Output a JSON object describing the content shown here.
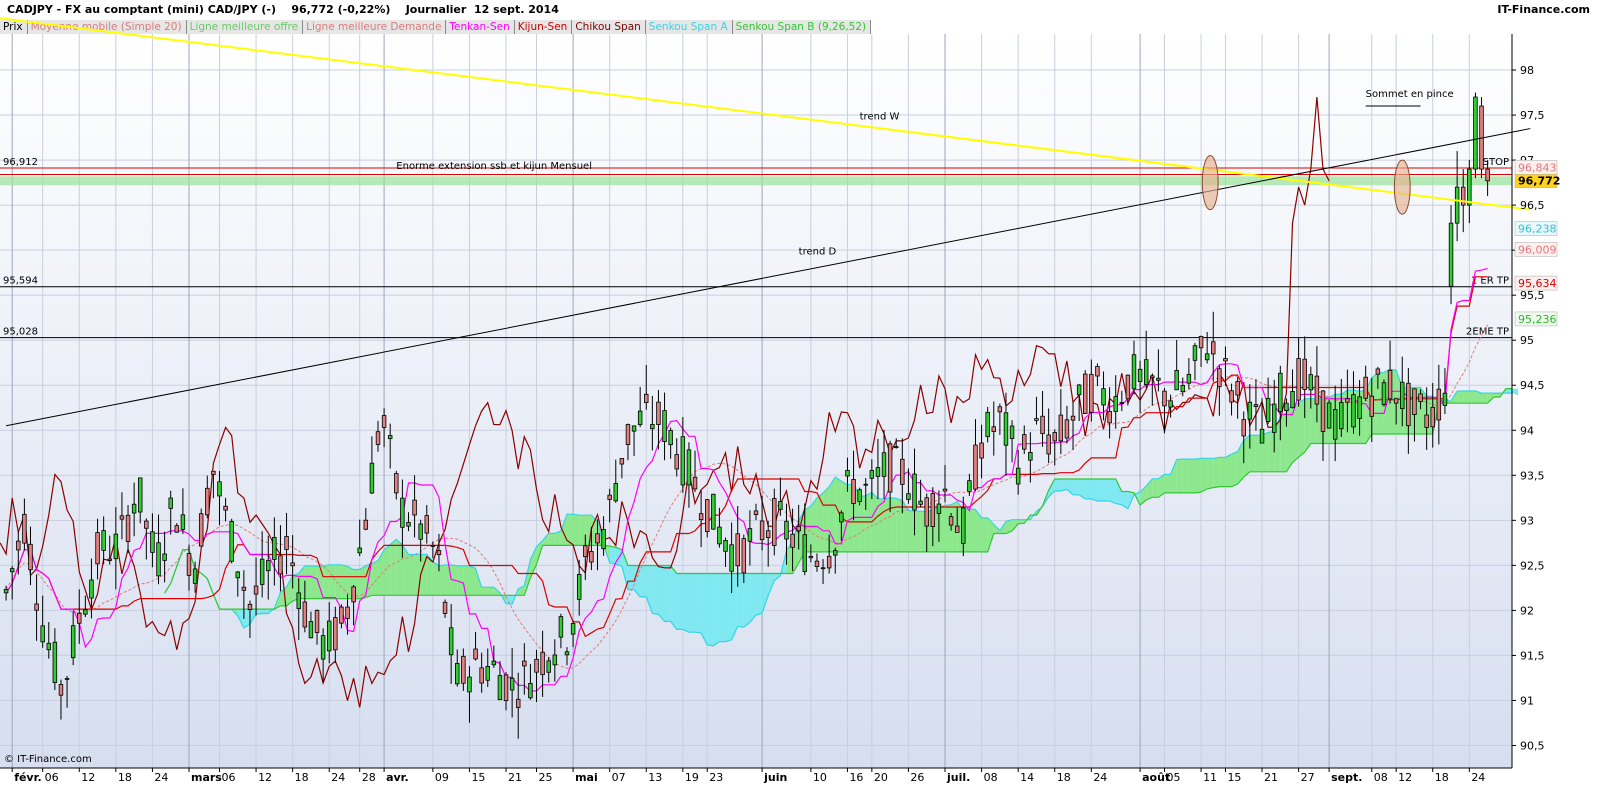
{
  "header": {
    "title": "CADJPY - FX au comptant (mini) CAD/JPY (-)    96,772 (-0,22%)    Journalier  12 sept. 2014",
    "site": "IT-Finance.com"
  },
  "legend": [
    {
      "label": "Prix",
      "color": "#000000"
    },
    {
      "label": "Moyenne mobile (Simple 20)",
      "color": "#e07a7a"
    },
    {
      "label": "Ligne meilleure offre",
      "color": "#66cc66"
    },
    {
      "label": "Ligne meilleure Demande",
      "color": "#e07a7a"
    },
    {
      "label": "Tenkan-Sen",
      "color": "#ff00ff"
    },
    {
      "label": "Kijun-Sen",
      "color": "#cc0000"
    },
    {
      "label": "Chikou Span",
      "color": "#800000"
    },
    {
      "label": "Senkou Span A",
      "color": "#33d6e6"
    },
    {
      "label": "Senkou Span B (9,26,52)",
      "color": "#33c833"
    }
  ],
  "colors": {
    "up": "#33cc33",
    "down": "#e08080",
    "wick": "#000000",
    "tenkan": "#ff00ff",
    "kijun": "#dd0000",
    "chikou": "#8b0000",
    "sma": "#e07a7a",
    "cloudBull": "#8de88d",
    "cloudBear": "#7fe8f0",
    "trendW": "#ffff00",
    "trendD": "#000000"
  },
  "chart_data": {
    "type": "candlestick",
    "title": "CADJPY - FX au comptant (mini) CAD/JPY (-)",
    "ylim": [
      90.25,
      98.4
    ],
    "yticks": [
      "98",
      "97,5",
      "97",
      "96,5",
      "96",
      "95,5",
      "95",
      "94,5",
      "94",
      "93,5",
      "93",
      "92,5",
      "92",
      "91,5",
      "91",
      "90,5"
    ],
    "ytick_values": [
      98,
      97.5,
      97,
      96.5,
      96,
      95.5,
      95,
      94.5,
      94,
      93.5,
      93,
      92.5,
      92,
      91.5,
      91,
      90.5
    ],
    "xlabels": [
      {
        "day": 1,
        "text": "févr.",
        "bold": true
      },
      {
        "day": 6,
        "text": "06"
      },
      {
        "day": 12,
        "text": "12"
      },
      {
        "day": 18,
        "text": "18"
      },
      {
        "day": 24,
        "text": "24"
      },
      {
        "day": 30,
        "text": "mars",
        "bold": true
      },
      {
        "day": 35,
        "text": "06"
      },
      {
        "day": 41,
        "text": "12"
      },
      {
        "day": 47,
        "text": "18"
      },
      {
        "day": 53,
        "text": "24"
      },
      {
        "day": 58,
        "text": "28"
      },
      {
        "day": 62,
        "text": "avr.",
        "bold": true
      },
      {
        "day": 70,
        "text": "09"
      },
      {
        "day": 76,
        "text": "15"
      },
      {
        "day": 82,
        "text": "21"
      },
      {
        "day": 87,
        "text": "25"
      },
      {
        "day": 93,
        "text": "mai",
        "bold": true
      },
      {
        "day": 99,
        "text": "07"
      },
      {
        "day": 105,
        "text": "13"
      },
      {
        "day": 111,
        "text": "19"
      },
      {
        "day": 115,
        "text": "23"
      },
      {
        "day": 124,
        "text": "juin",
        "bold": true
      },
      {
        "day": 132,
        "text": "10"
      },
      {
        "day": 138,
        "text": "16"
      },
      {
        "day": 142,
        "text": "20"
      },
      {
        "day": 148,
        "text": "26"
      },
      {
        "day": 154,
        "text": "juil.",
        "bold": true
      },
      {
        "day": 160,
        "text": "08"
      },
      {
        "day": 166,
        "text": "14"
      },
      {
        "day": 172,
        "text": "18"
      },
      {
        "day": 178,
        "text": "24"
      },
      {
        "day": 186,
        "text": "août",
        "bold": true
      },
      {
        "day": 190,
        "text": "05"
      },
      {
        "day": 196,
        "text": "11"
      },
      {
        "day": 200,
        "text": "15"
      },
      {
        "day": 206,
        "text": "21"
      },
      {
        "day": 212,
        "text": "27"
      },
      {
        "day": 217,
        "text": "sept.",
        "bold": true
      },
      {
        "day": 224,
        "text": "08"
      },
      {
        "day": 228,
        "text": "12"
      },
      {
        "day": 234,
        "text": "18"
      },
      {
        "day": 240,
        "text": "24"
      }
    ],
    "hlines": [
      {
        "name": "stop-line",
        "y": 96.912,
        "color": "#dd0000",
        "left_label": "96,912",
        "right_label": "STOP"
      },
      {
        "name": "stop-line-2",
        "y": 96.84,
        "color": "#dd0000",
        "left_label": "",
        "right_label": ""
      },
      {
        "name": "tp1-line",
        "y": 95.594,
        "color": "#000000",
        "left_label": "95,594",
        "right_label": "1 ER TP"
      },
      {
        "name": "tp2-line",
        "y": 95.028,
        "color": "#000000",
        "left_label": "95,028",
        "right_label": "2EME TP"
      },
      {
        "name": "sommet-line",
        "y": 97.6,
        "color": "#000000",
        "left_label": "",
        "right_label": ""
      }
    ],
    "green_zone": [
      96.72,
      96.82
    ],
    "trendlines": [
      {
        "name": "trend-w",
        "label": "trend W",
        "from": [
          -4,
          98.6
        ],
        "to": [
          250,
          96.45
        ],
        "color": "#ffff00",
        "label_at": [
          140,
          97.45
        ]
      },
      {
        "name": "trend-d",
        "label": "trend D",
        "from": [
          0,
          94.05
        ],
        "to": [
          250,
          97.35
        ],
        "color": "#000000",
        "label_at": [
          130,
          95.95
        ]
      }
    ],
    "annotations": [
      {
        "name": "ssb-annotation",
        "text": "Enorme extension ssb et kijun Mensuel",
        "at": [
          64,
          96.9
        ]
      },
      {
        "name": "sommet-annotation",
        "text": "Sommet en pince",
        "at": [
          223,
          97.7
        ]
      }
    ],
    "ellipses": [
      {
        "name": "ellipse-aug",
        "cx": 197.5,
        "cy": 96.75,
        "rx": 1.3,
        "ry": 0.3
      },
      {
        "name": "ellipse-sept",
        "cx": 229,
        "cy": 96.7,
        "rx": 1.3,
        "ry": 0.3
      }
    ],
    "price_badges": [
      {
        "name": "badge-price",
        "text": "96,772",
        "y": 96.772,
        "bg": "#ffd21f",
        "color": "#000000"
      },
      {
        "name": "badge-kijun",
        "text": "96,843",
        "y": 96.92,
        "bg": "#fff0f0",
        "color": "#e07a7a"
      },
      {
        "name": "badge-senkou-a",
        "text": "96,238",
        "y": 96.238,
        "bg": "#eaf9fc",
        "color": "#33c0d6"
      },
      {
        "name": "badge-sma",
        "text": "96,009",
        "y": 96.009,
        "bg": "#fff0f0",
        "color": "#e07a7a"
      },
      {
        "name": "badge-kijun2",
        "text": "95,634",
        "y": 95.634,
        "bg": "#fff0f0",
        "color": "#dd0000"
      },
      {
        "name": "badge-senkou-b",
        "text": "95,236",
        "y": 95.236,
        "bg": "#eefcee",
        "color": "#33b033"
      }
    ],
    "footer_text": "© IT-Finance.com",
    "price_key": [
      [
        92.45,
        92.2,
        92.85,
        91.9
      ],
      [
        92.65,
        93.0,
        93.15,
        92.4
      ],
      [
        91.6,
        91.8,
        92.2,
        91.3
      ],
      [
        92.45,
        91.1,
        92.6,
        90.9
      ],
      [
        91.65,
        92.0,
        92.25,
        91.3
      ],
      [
        92.3,
        92.7,
        93.4,
        92.0
      ],
      [
        92.3,
        92.7,
        93.1,
        92.0
      ],
      [
        93.0,
        93.35,
        93.7,
        92.7
      ],
      [
        93.3,
        92.5,
        93.5,
        92.3
      ],
      [
        93.4,
        93.2,
        93.7,
        92.7
      ],
      [
        92.6,
        92.45,
        92.9,
        92.2
      ],
      [
        92.9,
        93.6,
        93.75,
        92.6
      ],
      [
        93.5,
        92.8,
        93.65,
        92.5
      ],
      [
        92.5,
        92.05,
        92.7,
        91.8
      ],
      [
        92.2,
        92.45,
        92.8,
        91.8
      ],
      [
        92.35,
        92.75,
        92.9,
        92.1
      ],
      [
        92.65,
        91.95,
        92.8,
        91.7
      ],
      [
        92.2,
        91.6,
        92.4,
        91.3
      ],
      [
        91.7,
        91.85,
        92.1,
        91.5
      ],
      [
        91.85,
        92.8,
        93.0,
        91.7
      ],
      [
        92.75,
        94.2,
        94.35,
        92.7
      ],
      [
        94.1,
        93.15,
        94.3,
        93.0
      ],
      [
        93.15,
        92.95,
        93.4,
        92.7
      ],
      [
        92.9,
        92.6,
        93.1,
        92.35
      ],
      [
        92.6,
        91.2,
        92.7,
        91.0
      ],
      [
        91.2,
        91.4,
        91.6,
        91.0
      ],
      [
        91.4,
        91.35,
        91.55,
        91.2
      ],
      [
        91.3,
        91.15,
        91.5,
        91.0
      ],
      [
        91.15,
        91.3,
        91.5,
        90.8
      ],
      [
        91.3,
        91.6,
        91.75,
        91.1
      ],
      [
        91.6,
        91.75,
        92.0,
        91.4
      ],
      [
        91.75,
        92.6,
        92.8,
        91.7
      ],
      [
        92.6,
        92.95,
        93.3,
        92.5
      ],
      [
        92.95,
        93.9,
        94.1,
        92.9
      ],
      [
        93.9,
        94.15,
        94.3,
        93.8
      ],
      [
        94.05,
        94.1,
        94.25,
        93.9
      ],
      [
        94.1,
        93.7,
        94.3,
        93.5
      ],
      [
        93.9,
        93.3,
        94.1,
        93.1
      ],
      [
        93.25,
        92.9,
        93.35,
        92.7
      ],
      [
        92.95,
        92.6,
        93.1,
        92.4
      ],
      [
        92.7,
        92.85,
        93.1,
        92.45
      ],
      [
        92.85,
        93.0,
        93.2,
        92.7
      ],
      [
        93.05,
        92.8,
        93.2,
        92.6
      ],
      [
        92.8,
        92.6,
        92.95,
        92.4
      ],
      [
        92.6,
        92.7,
        92.95,
        92.4
      ],
      [
        92.7,
        93.4,
        93.55,
        92.6
      ],
      [
        93.35,
        93.3,
        93.5,
        93.1
      ],
      [
        93.3,
        93.6,
        93.85,
        93.1
      ],
      [
        93.65,
        93.5,
        94.0,
        93.3
      ],
      [
        93.5,
        93.1,
        93.8,
        93.0
      ],
      [
        93.1,
        93.35,
        93.55,
        92.9
      ],
      [
        93.35,
        92.85,
        93.45,
        92.7
      ],
      [
        92.85,
        93.9,
        94.0,
        92.6
      ],
      [
        93.9,
        94.1,
        94.2,
        93.7
      ],
      [
        94.1,
        93.65,
        94.15,
        93.5
      ],
      [
        93.7,
        94.0,
        94.15,
        93.6
      ],
      [
        94.0,
        93.85,
        94.1,
        93.6
      ],
      [
        93.85,
        94.2,
        94.45,
        93.6
      ],
      [
        94.2,
        94.5,
        94.9,
        94.1
      ],
      [
        94.5,
        94.3,
        94.8,
        94.2
      ],
      [
        94.35,
        94.6,
        94.95,
        94.2
      ],
      [
        94.6,
        94.5,
        95.3,
        94.3
      ],
      [
        95.3,
        94.4,
        95.4,
        94.3
      ],
      [
        94.4,
        94.5,
        95.6,
        94.3
      ],
      [
        95.5,
        95.0,
        95.7,
        94.9
      ],
      [
        95.0,
        94.6,
        95.2,
        94.4
      ],
      [
        94.6,
        94.2,
        94.9,
        94.0
      ],
      [
        94.2,
        94.0,
        94.45,
        93.9
      ],
      [
        93.95,
        94.4,
        94.6,
        93.8
      ],
      [
        94.4,
        94.6,
        94.8,
        94.3
      ],
      [
        94.65,
        94.3,
        94.75,
        94.1
      ],
      [
        94.3,
        94.05,
        94.6,
        93.9
      ],
      [
        94.05,
        94.3,
        94.45,
        93.9
      ],
      [
        94.3,
        94.45,
        94.6,
        94.2
      ],
      [
        94.45,
        94.5,
        94.7,
        94.3
      ],
      [
        94.5,
        94.2,
        94.6,
        94.0
      ],
      [
        94.2,
        94.15,
        94.35,
        94.0
      ],
      [
        94.15,
        94.6,
        94.75,
        94.0
      ],
      [
        94.6,
        95.5,
        95.7,
        94.5
      ],
      [
        95.5,
        95.6,
        96.1,
        95.4
      ]
    ]
  }
}
